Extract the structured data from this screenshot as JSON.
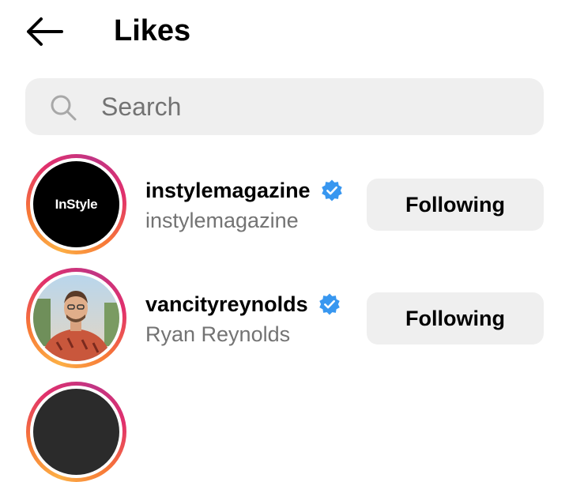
{
  "header": {
    "back_icon": "arrow-left-icon",
    "title": "Likes"
  },
  "search": {
    "icon": "search-icon",
    "placeholder": "Search",
    "value": ""
  },
  "likes": [
    {
      "username": "instylemagazine",
      "verified": true,
      "subtitle": "instylemagazine",
      "avatar_text": "InStyle",
      "button_label": "Following"
    },
    {
      "username": "vancityreynolds",
      "verified": true,
      "subtitle": "Ryan Reynolds",
      "avatar_text": "",
      "button_label": "Following"
    }
  ],
  "colors": {
    "verified_blue": "#3897f0",
    "button_bg": "#efefef",
    "secondary_text": "#737373"
  }
}
